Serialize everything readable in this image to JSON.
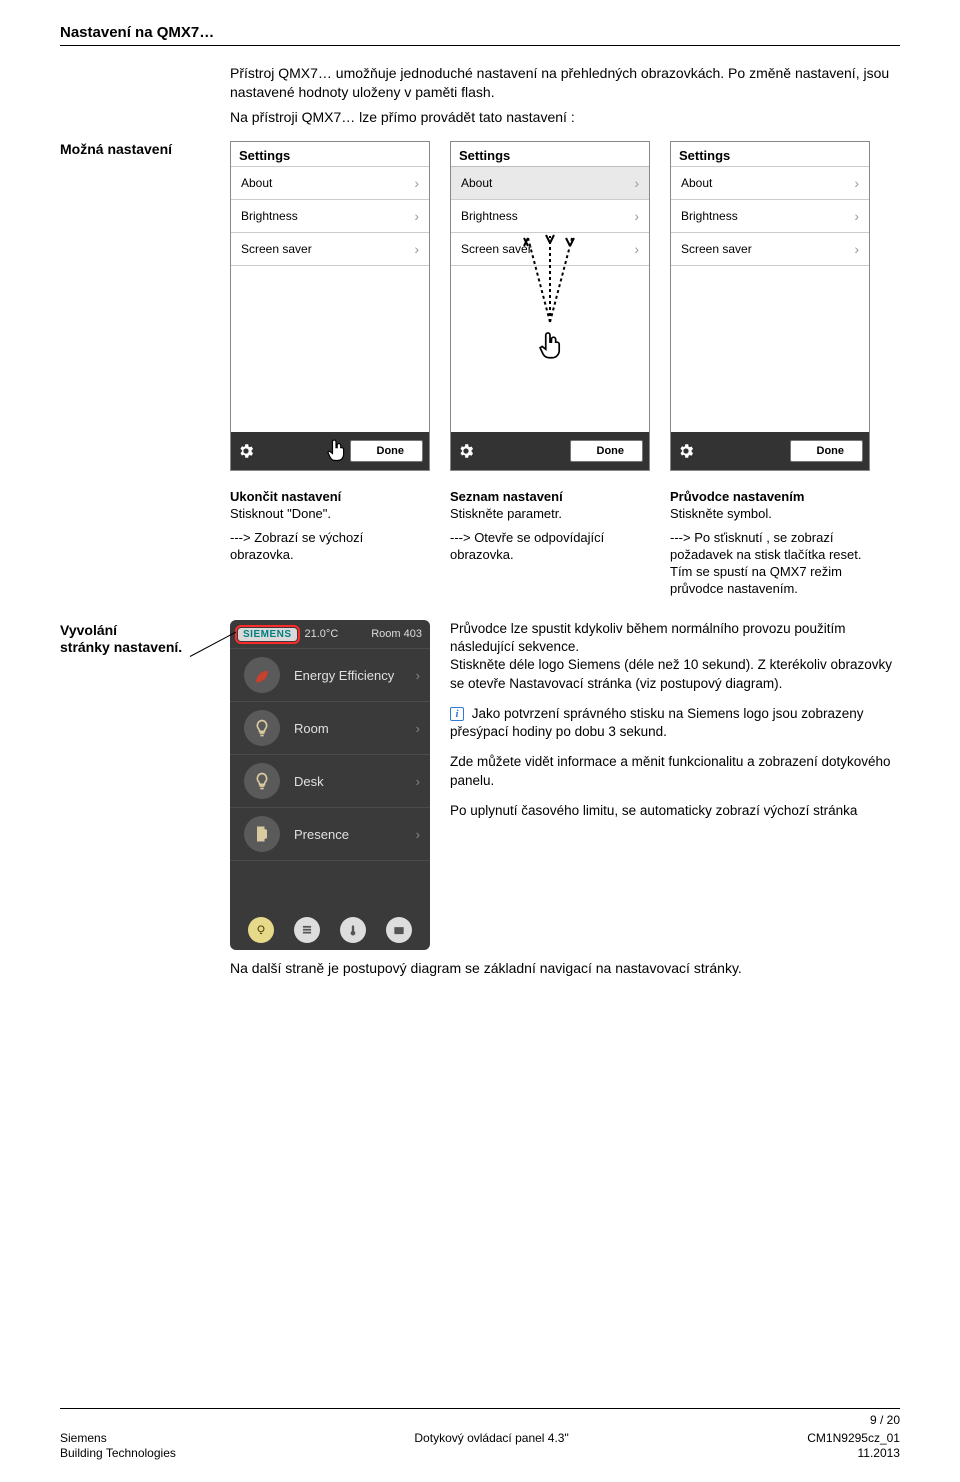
{
  "title": "Nastavení na QMX7…",
  "intro": [
    "Přístroj QMX7… umožňuje jednoduché nastavení na přehledných obrazovkách. Po změně nastavení, jsou nastavené hodnoty uloženy v paměti flash.",
    "Na přístroji  QMX7… lze přímo provádět tato nastavení :"
  ],
  "sidebar": {
    "mozna": "Možná nastavení",
    "vyvolani1": "Vyvolání",
    "vyvolani2": "stránky nastavení."
  },
  "screens": {
    "title": "Settings",
    "items": [
      "About",
      "Brightness",
      "Screen saver"
    ],
    "done": "Done"
  },
  "captions": {
    "c1a": "Ukončit nastavení",
    "c1b": "Stisknout \"Done\".",
    "c2a": "Seznam nastavení",
    "c2b": "Stiskněte parametr.",
    "c3a": "Průvodce nastavením",
    "c3b": "Stiskněte symbol.",
    "d1": "---> Zobrazí se výchozí obrazovka.",
    "d2": "---> Otevře se odpovídající obrazovka.",
    "d3": "---> Po sťisknutí , se zobrazí požadavek na stisk tlačítka reset. Tím se spustí na QMX7 režim průvodce nastavením."
  },
  "device": {
    "logo": "SIEMENS",
    "temp": "21.0°C",
    "room": "Room 403",
    "items": [
      {
        "label": "Energy Efficiency",
        "icon": "leaf"
      },
      {
        "label": "Room",
        "icon": "bulb"
      },
      {
        "label": "Desk",
        "icon": "bulb"
      },
      {
        "label": "Presence",
        "icon": "door"
      }
    ]
  },
  "sec2": {
    "p1": "Průvodce lze spustit kdykoliv během normálního provozu použitím následující sekvence.",
    "p2": "Stiskněte déle logo Siemens (déle než 10 sekund). Z kterékoliv obrazovky se otevře Nastavovací stránka (viz postupový diagram).",
    "p3": "Jako potvrzení správného stisku na Siemens logo jsou zobrazeny přesýpací hodiny po dobu 3 sekund.",
    "p4": "Zde můžete vidět informace a měnit funkcionalitu a zobrazení dotykového panelu.",
    "p5": "Po uplynutí časového limitu, se automaticky zobrazí výchozí stránka"
  },
  "closing": "Na další straně je postupový diagram se základní navigací na nastavovací stránky.",
  "footer": {
    "page": "9 / 20",
    "l1": "Siemens",
    "l2": "Building Technologies",
    "c1": "Dotykový ovládací panel 4.3\"",
    "r1": "CM1N9295cz_01",
    "r2": "11.2013"
  }
}
